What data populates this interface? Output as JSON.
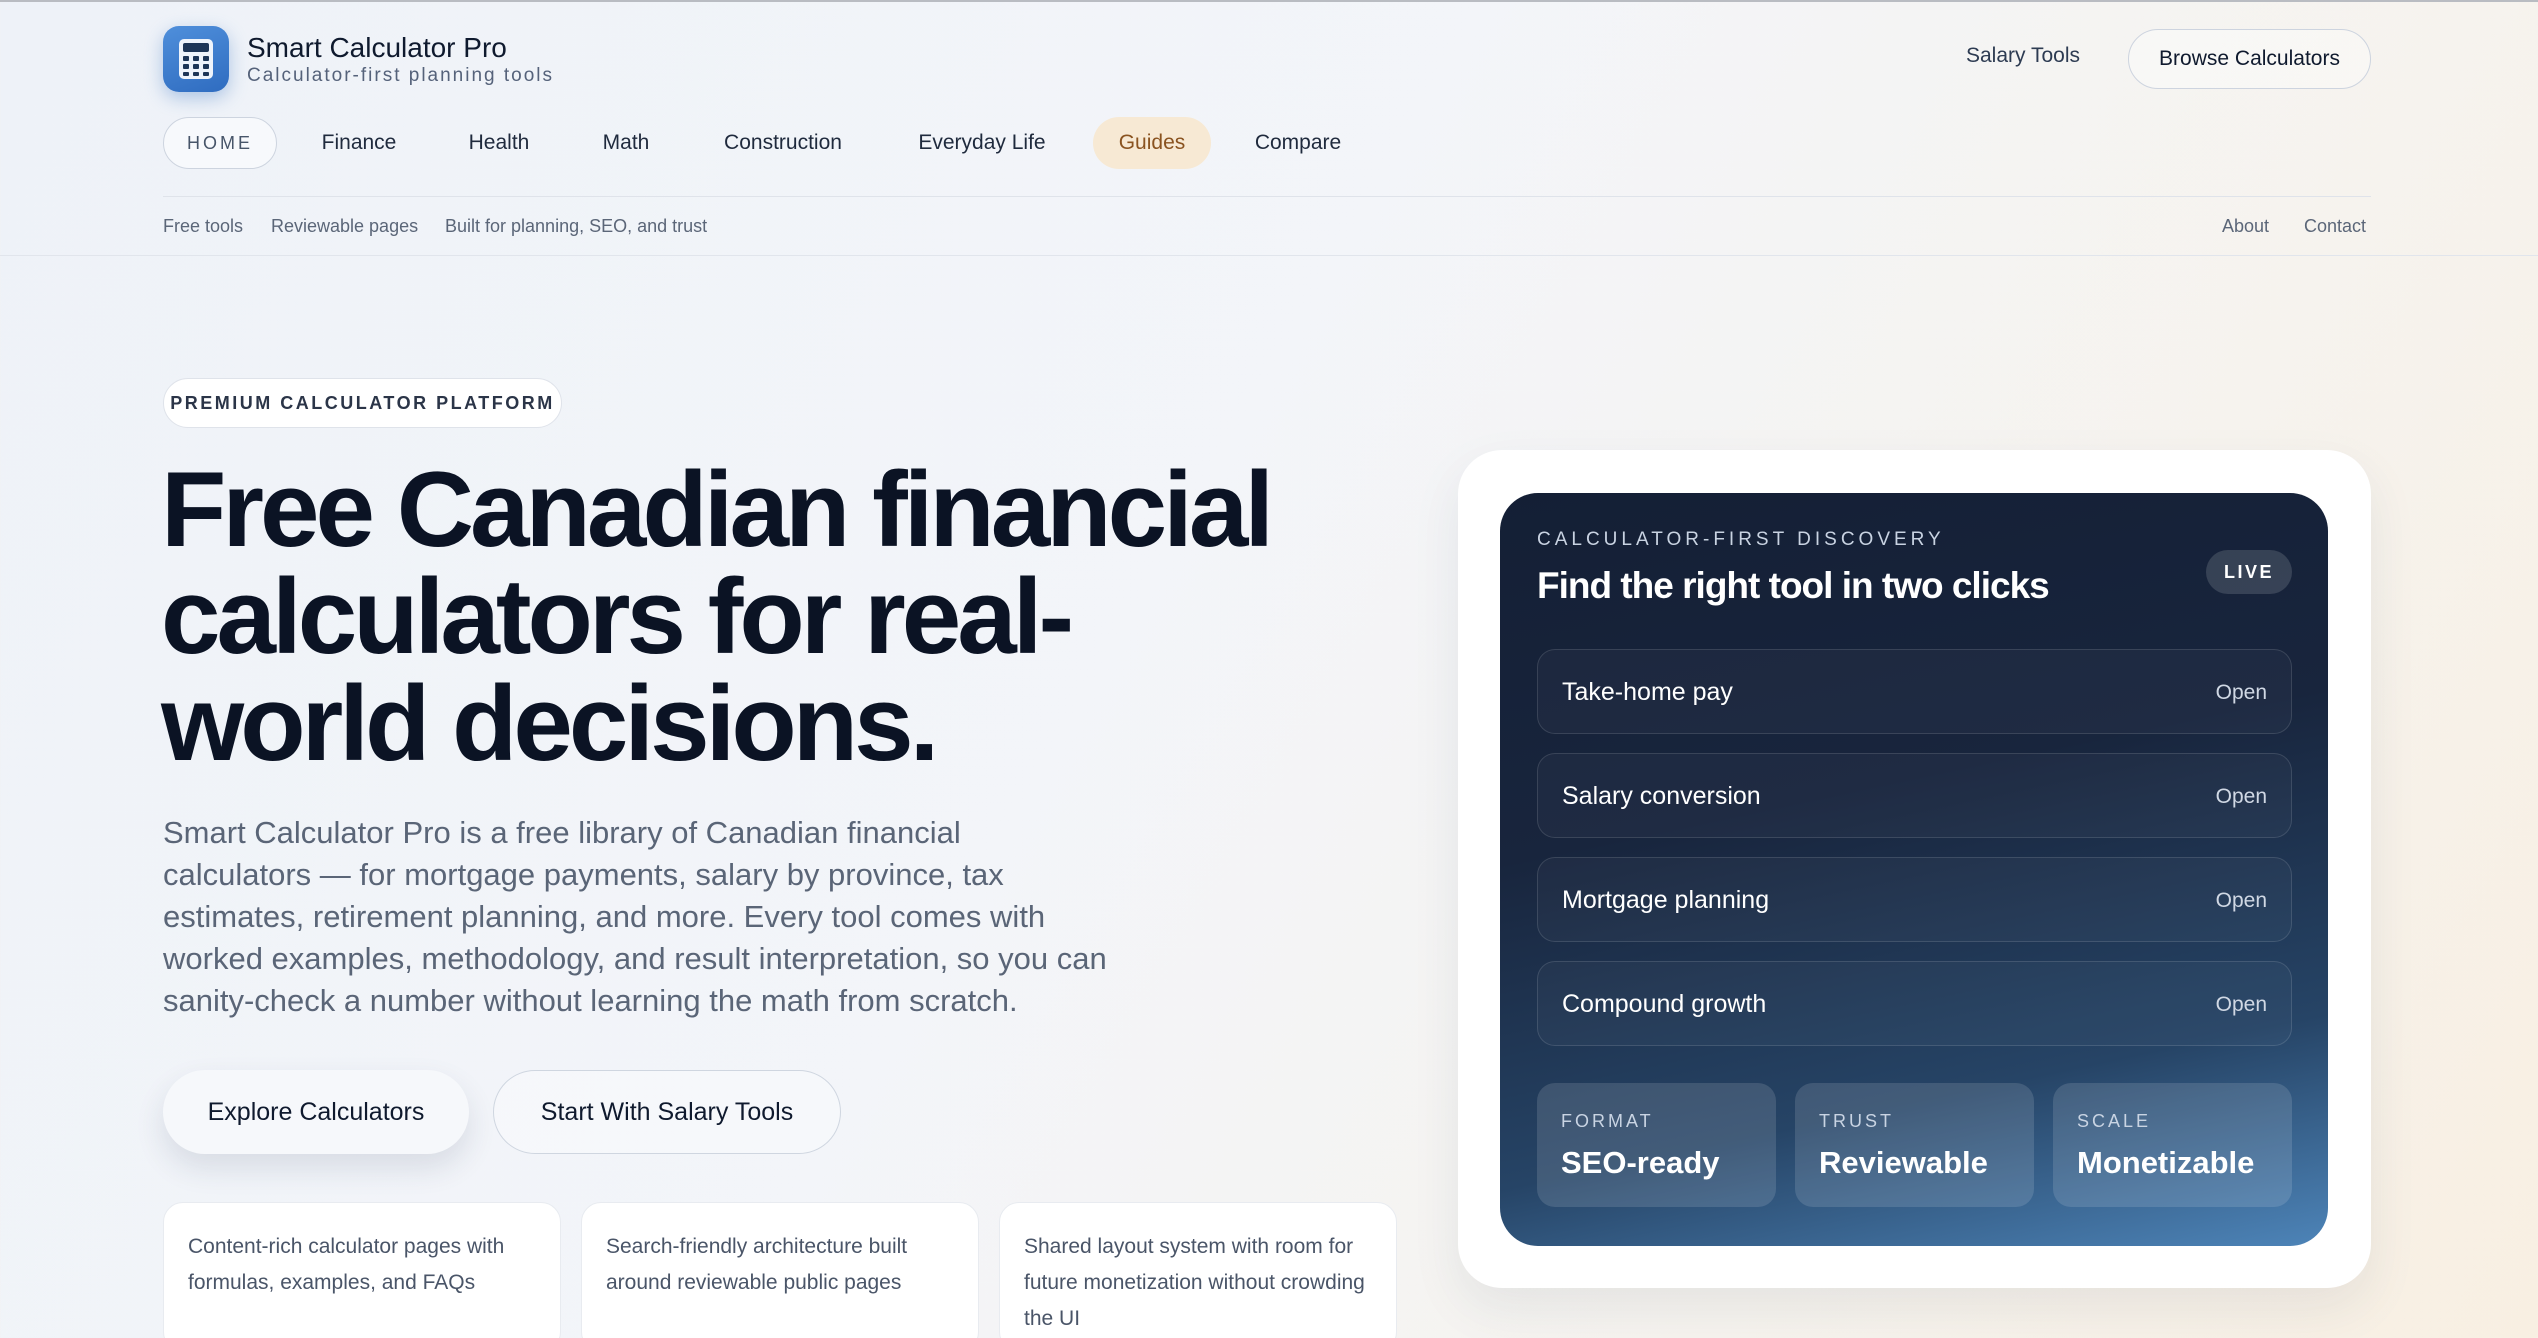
{
  "brand": {
    "title": "Smart Calculator Pro",
    "subtitle": "Calculator-first planning tools",
    "icon": "calculator-icon",
    "accent": "#3b7dd0"
  },
  "header": {
    "salary_link": "Salary Tools",
    "browse_button": "Browse Calculators"
  },
  "nav": {
    "items": [
      "HOME",
      "Finance",
      "Health",
      "Math",
      "Construction",
      "Everyday Life",
      "Guides",
      "Compare"
    ],
    "active": "HOME",
    "highlighted": "Guides"
  },
  "subnav": {
    "left": [
      "Free tools",
      "Reviewable pages",
      "Built for planning, SEO, and trust"
    ],
    "right": [
      "About",
      "Contact"
    ]
  },
  "hero": {
    "badge": "PREMIUM CALCULATOR PLATFORM",
    "title": "Free Canadian financial calculators for real-world decisions.",
    "body": "Smart Calculator Pro is a free library of Canadian financial calculators — for mortgage payments, salary by province, tax estimates, retirement planning, and more. Every tool comes with worked examples, methodology, and result interpretation, so you can sanity-check a number without learning the math from scratch.",
    "cta_primary": "Explore Calculators",
    "cta_secondary": "Start With Salary Tools"
  },
  "features": [
    "Content-rich calculator pages with formulas, examples, and FAQs",
    "Search-friendly architecture built around reviewable public pages",
    "Shared layout system with room for future monetization without crowding the UI"
  ],
  "discovery": {
    "kicker": "CALCULATOR-FIRST DISCOVERY",
    "title": "Find the right tool in two clicks",
    "status": "LIVE",
    "tools": [
      {
        "name": "Take-home pay",
        "action": "Open"
      },
      {
        "name": "Salary conversion",
        "action": "Open"
      },
      {
        "name": "Mortgage planning",
        "action": "Open"
      },
      {
        "name": "Compound growth",
        "action": "Open"
      }
    ],
    "stats": [
      {
        "label": "FORMAT",
        "value": "SEO-ready"
      },
      {
        "label": "TRUST",
        "value": "Reviewable"
      },
      {
        "label": "SCALE",
        "value": "Monetizable"
      }
    ]
  }
}
